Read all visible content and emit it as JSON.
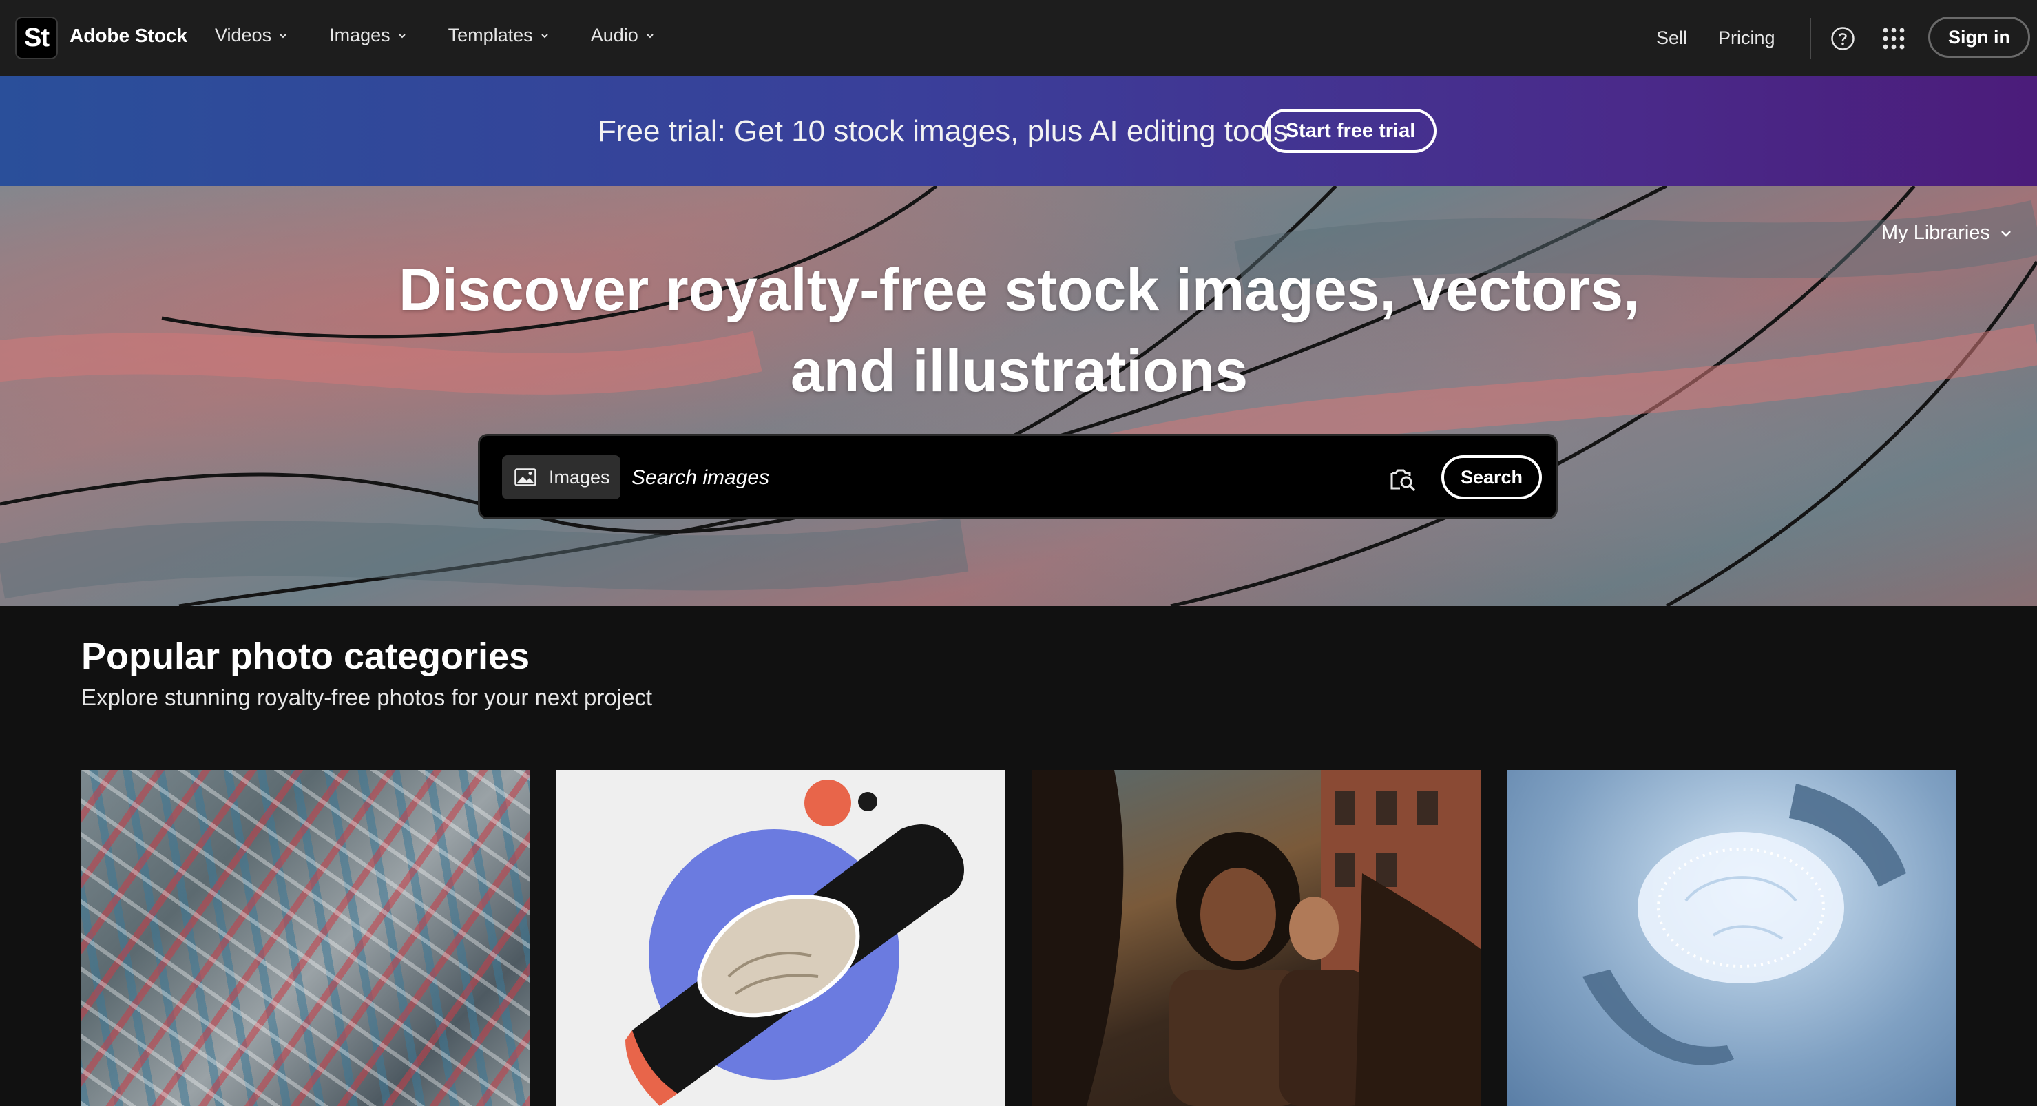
{
  "header": {
    "logo_text": "St",
    "brand": "Adobe Stock",
    "menu": [
      {
        "label": "Videos"
      },
      {
        "label": "Images"
      },
      {
        "label": "Templates"
      },
      {
        "label": "Audio"
      }
    ],
    "sell": "Sell",
    "pricing": "Pricing",
    "sign_in": "Sign in"
  },
  "promo": {
    "text": "Free trial: Get 10 stock images, plus AI editing tools",
    "cta": "Start free trial"
  },
  "hero": {
    "my_libraries": "My Libraries",
    "title": "Discover royalty-free stock images, vectors, and illustrations",
    "search": {
      "scope_label": "Images",
      "placeholder": "Search images",
      "value": "",
      "button": "Search"
    }
  },
  "categories": {
    "title": "Popular photo categories",
    "subtitle": "Explore stunning royalty-free photos for your next project",
    "cards": [
      {
        "image": "crumpled-foil-texture"
      },
      {
        "image": "handshake-collage"
      },
      {
        "image": "friends-street-photo"
      },
      {
        "image": "glowing-brain-hands"
      }
    ]
  },
  "colors": {
    "nav_bg": "#1d1d1d",
    "page_bg": "#111111",
    "promo_start": "#2a4f9a",
    "promo_end": "#4b1c7a"
  }
}
